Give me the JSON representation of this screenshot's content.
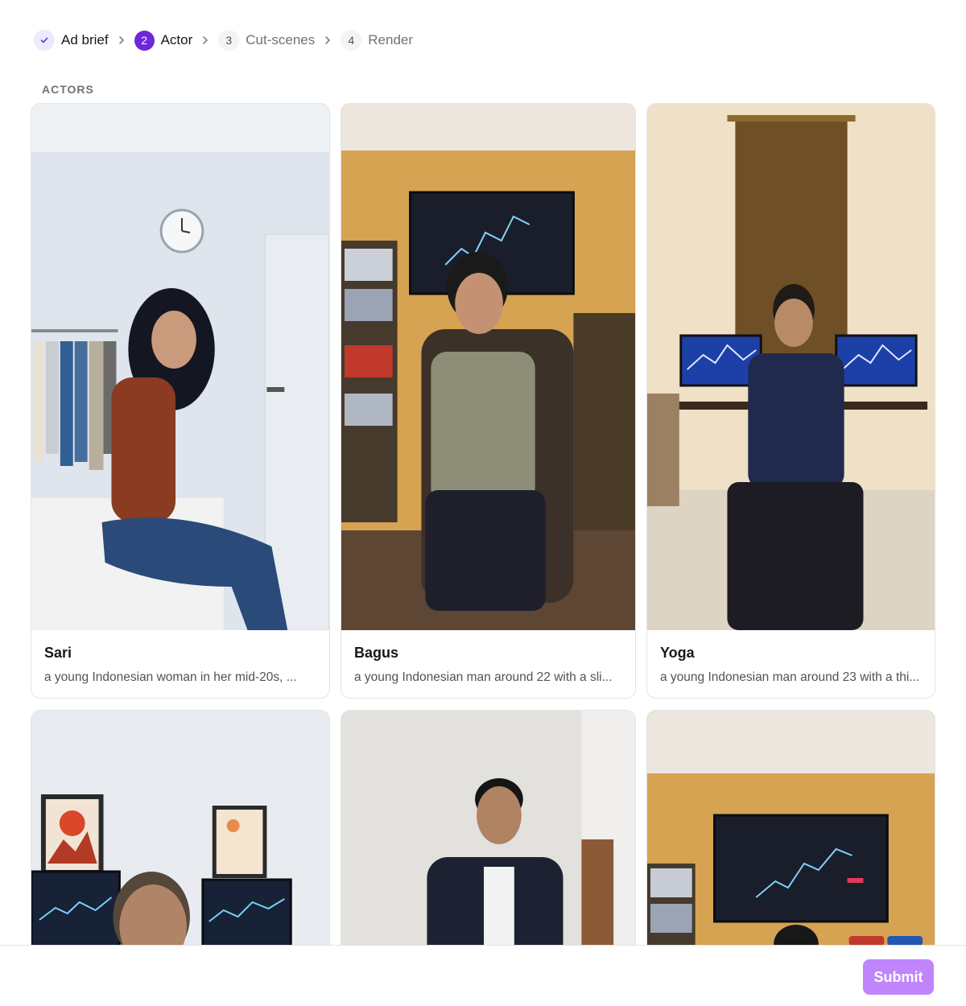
{
  "stepper": {
    "steps": [
      {
        "number": "1",
        "label": "Ad brief",
        "state": "done"
      },
      {
        "number": "2",
        "label": "Actor",
        "state": "active"
      },
      {
        "number": "3",
        "label": "Cut-scenes",
        "state": "pending"
      },
      {
        "number": "4",
        "label": "Render",
        "state": "pending"
      }
    ]
  },
  "section": {
    "label": "ACTORS"
  },
  "actors": [
    {
      "name": "Sari",
      "description": "a young Indonesian woman in her mid-20s, ..."
    },
    {
      "name": "Bagus",
      "description": "a young Indonesian man around 22 with a sli..."
    },
    {
      "name": "Yoga",
      "description": "a young Indonesian man around 23 with a thi..."
    },
    {
      "name": "",
      "description": ""
    },
    {
      "name": "",
      "description": ""
    },
    {
      "name": "",
      "description": ""
    }
  ],
  "footer": {
    "submit_label": "Submit"
  },
  "colors": {
    "accent": "#6d28d9",
    "accent_light": "#ede9fe",
    "submit_bg": "#c084fc"
  }
}
